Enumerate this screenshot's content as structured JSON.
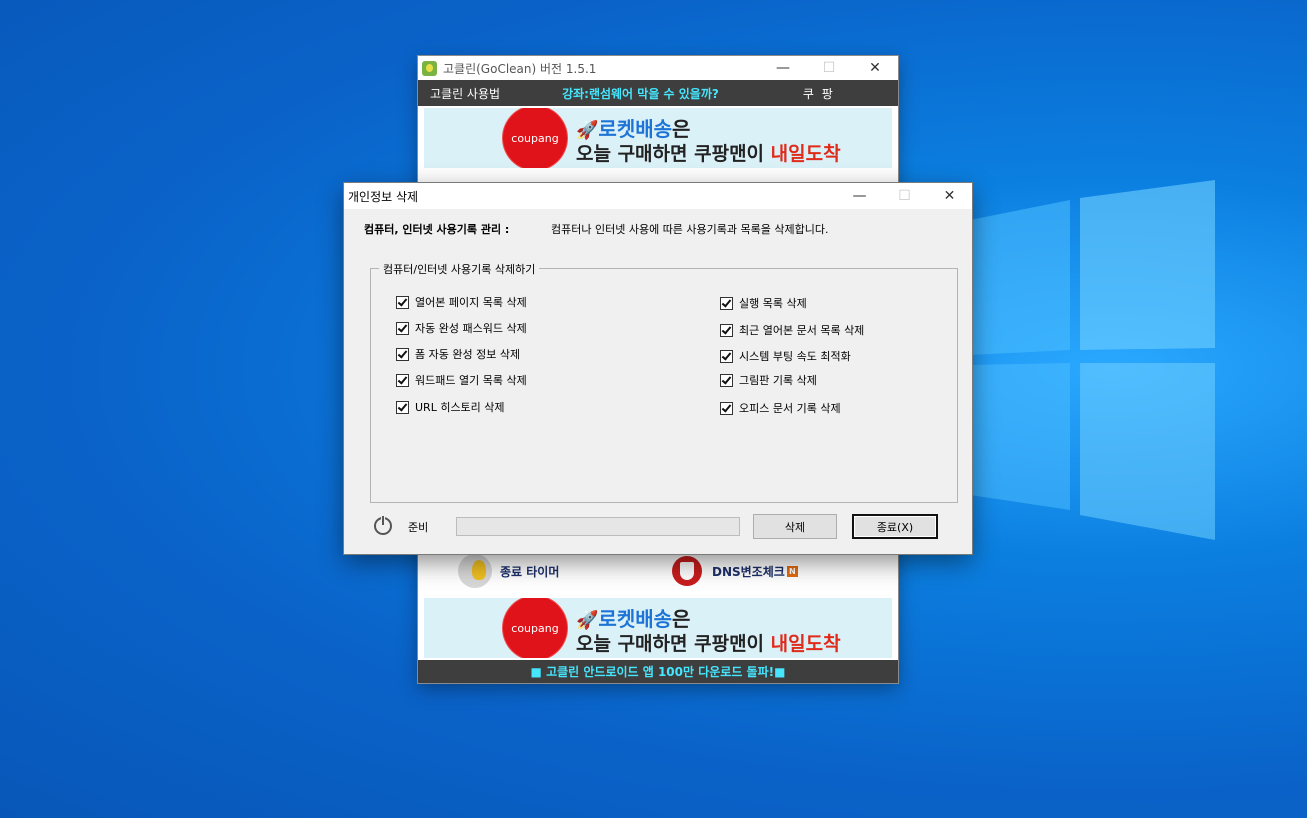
{
  "main_window": {
    "title": "고클린(GoClean) 버전 1.5.1",
    "menu": {
      "howto": "고클린 사용법",
      "lecture": "강좌:랜섬웨어 막을 수 있을까?",
      "coupang": "쿠 팡"
    },
    "banner": {
      "badge": "coupang",
      "rocket_icon": "🚀",
      "line1_brand": "로켓배송",
      "line1_suffix": "은",
      "line2_prefix": "오늘 구매하면 쿠팡맨이 ",
      "line2_highlight": "내일도착"
    },
    "tools": {
      "timer_label": "종료 타이머",
      "dns_label": "DNS변조체크",
      "dns_badge": "N"
    },
    "footer": "■ 고클린 안드로이드 앱 100만 다운로드 돌파!■"
  },
  "dialog": {
    "title": "개인정보 삭제",
    "info_label": "컴퓨터, 인터넷 사용기록 관리 :",
    "info_text": "컴퓨터나 인터넷 사용에 따른 사용기록과 목록을 삭제합니다.",
    "group_title": "컴퓨터/인터넷 사용기록 삭제하기",
    "left_options": [
      {
        "label": "열어본 페이지 목록 삭제",
        "checked": true
      },
      {
        "label": "자동 완성 패스워드 삭제",
        "checked": true
      },
      {
        "label": "폼 자동 완성 정보 삭제",
        "checked": true
      },
      {
        "label": "워드패드 열기 목록 삭제",
        "checked": true
      },
      {
        "label": "URL 히스토리 삭제",
        "checked": true
      }
    ],
    "right_options": [
      {
        "label": "실행 목록 삭제",
        "checked": true
      },
      {
        "label": "최근 열어본 문서 목록 삭제",
        "checked": true
      },
      {
        "label": "시스템 부팅 속도 최적화",
        "checked": true
      },
      {
        "label": "그림판 기록 삭제",
        "checked": true
      },
      {
        "label": "오피스 문서 기록 삭제",
        "checked": true
      }
    ],
    "status": "준비",
    "progress": 0,
    "delete_button": "삭제",
    "close_button": "종료(X)"
  },
  "window_controls": {
    "minimize": "—",
    "maximize": "☐",
    "close": "✕"
  },
  "colors": {
    "menu_bg": "#3e3e3e",
    "menu_accent": "#46e6ff",
    "desktop": "#0a63c9"
  }
}
